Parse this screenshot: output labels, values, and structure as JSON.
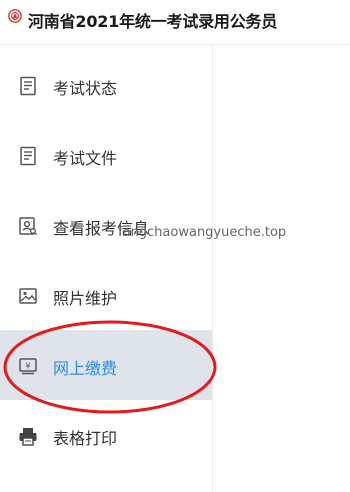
{
  "header": {
    "title": "河南省2021年统一考试录用公务员",
    "logo_icon": "exam-emblem-icon",
    "brand_color": "#d9372b"
  },
  "sidebar": {
    "items": [
      {
        "label": "考试状态",
        "icon": "document-list-icon"
      },
      {
        "label": "考试文件",
        "icon": "document-list-icon"
      },
      {
        "label": "查看报考信息",
        "icon": "profile-search-icon"
      },
      {
        "label": "照片维护",
        "icon": "image-icon"
      },
      {
        "label": "网上缴费",
        "icon": "payment-icon",
        "active": true
      },
      {
        "label": "表格打印",
        "icon": "printer-icon"
      }
    ],
    "active_bg": "#dfe3ea",
    "active_color": "#2d8cf0"
  },
  "watermark": "fangchaowangyueche.top",
  "annotation_color": "#e51b1b"
}
